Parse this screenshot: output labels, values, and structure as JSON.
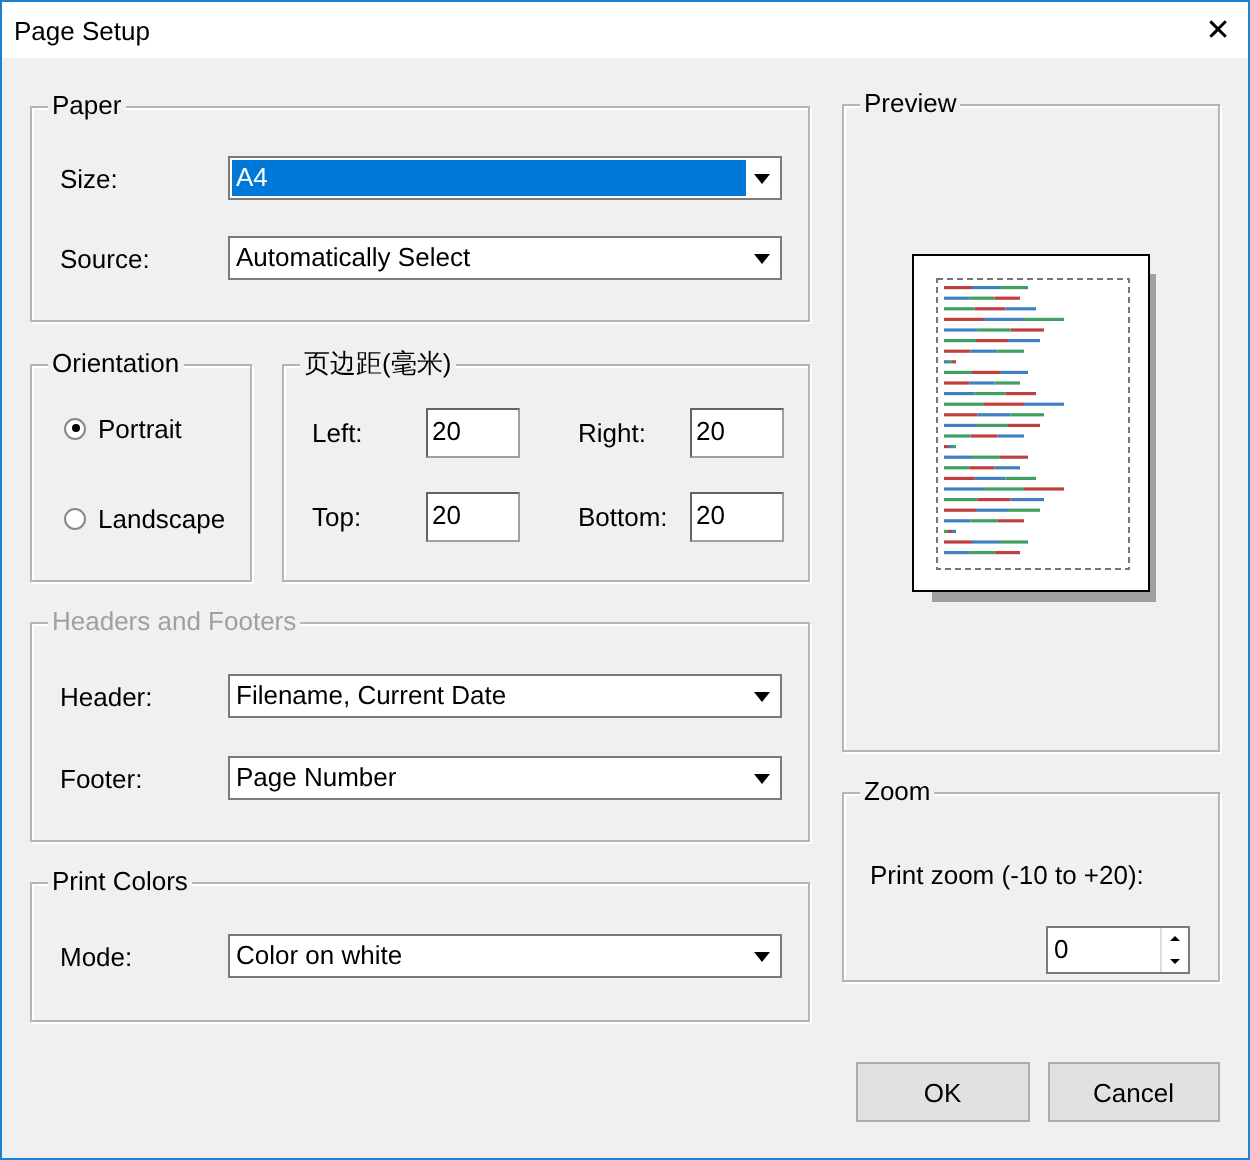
{
  "window": {
    "title": "Page Setup",
    "close": "✕"
  },
  "paper": {
    "label": "Paper",
    "size": {
      "label": "Size:",
      "value": "A4",
      "highlighted": true
    },
    "source": {
      "label": "Source:",
      "value": "Automatically Select",
      "highlighted": false
    }
  },
  "orientation": {
    "label": "Orientation",
    "options": [
      {
        "label": "Portrait",
        "selected": true
      },
      {
        "label": "Landscape",
        "selected": false
      }
    ]
  },
  "margins": {
    "label": "页边距(毫米)",
    "fields": [
      {
        "label": "Left:",
        "value": "20"
      },
      {
        "label": "Right:",
        "value": "20"
      },
      {
        "label": "Top:",
        "value": "20"
      },
      {
        "label": "Bottom:",
        "value": "20"
      }
    ]
  },
  "headers_footers": {
    "label": "Headers and Footers",
    "disabled": true,
    "header": {
      "label": "Header:",
      "value": "Filename, Current Date"
    },
    "footer": {
      "label": "Footer:",
      "value": "Page Number"
    }
  },
  "print_colors": {
    "label": "Print Colors",
    "mode": {
      "label": "Mode:",
      "value": "Color on white"
    }
  },
  "preview": {
    "label": "Preview"
  },
  "zoom": {
    "label": "Zoom",
    "field_label": "Print zoom (-10 to +20):",
    "value": "0"
  },
  "buttons": [
    "OK",
    "Cancel"
  ]
}
